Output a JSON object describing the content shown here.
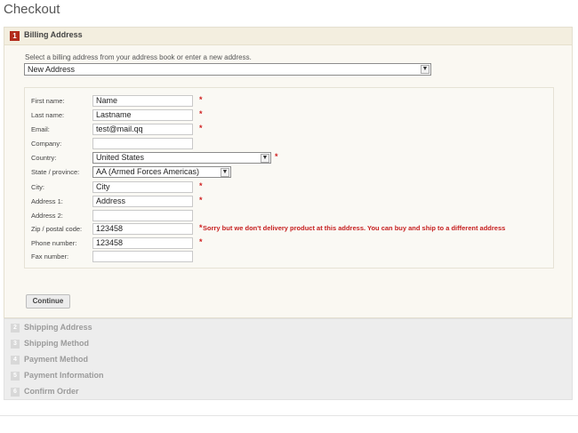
{
  "page": {
    "title": "Checkout"
  },
  "billing": {
    "step_number": "1",
    "title": "Billing Address",
    "select_note": "Select a billing address from your address book or enter a new address.",
    "address_selected": "New Address"
  },
  "form": {
    "first_name": {
      "label": "First name:",
      "value": "Name",
      "required": "*"
    },
    "last_name": {
      "label": "Last name:",
      "value": "Lastname",
      "required": "*"
    },
    "email": {
      "label": "Email:",
      "value": "test@mail.qq",
      "required": "*"
    },
    "company": {
      "label": "Company:",
      "value": ""
    },
    "country": {
      "label": "Country:",
      "value": "United States",
      "required": "*"
    },
    "state": {
      "label": "State / province:",
      "value": "AA (Armed Forces Americas)"
    },
    "city": {
      "label": "City:",
      "value": "City",
      "required": "*"
    },
    "address1": {
      "label": "Address 1:",
      "value": "Address",
      "required": "*"
    },
    "address2": {
      "label": "Address 2:",
      "value": ""
    },
    "zip": {
      "label": "Zip / postal code:",
      "value": "123458",
      "required": "*",
      "error": "Sorry but we don't delivery product at this address. You can buy and ship to a different address"
    },
    "phone": {
      "label": "Phone number:",
      "value": "123458",
      "required": "*"
    },
    "fax": {
      "label": "Fax number:",
      "value": ""
    }
  },
  "buttons": {
    "continue": "Continue"
  },
  "steps": [
    {
      "number": "2",
      "title": "Shipping Address"
    },
    {
      "number": "3",
      "title": "Shipping Method"
    },
    {
      "number": "4",
      "title": "Payment Method"
    },
    {
      "number": "5",
      "title": "Payment Information"
    },
    {
      "number": "6",
      "title": "Confirm Order"
    }
  ],
  "colors": {
    "accent": "#b22b1b",
    "error": "#c62020",
    "panel_bg": "#faf8f2"
  }
}
